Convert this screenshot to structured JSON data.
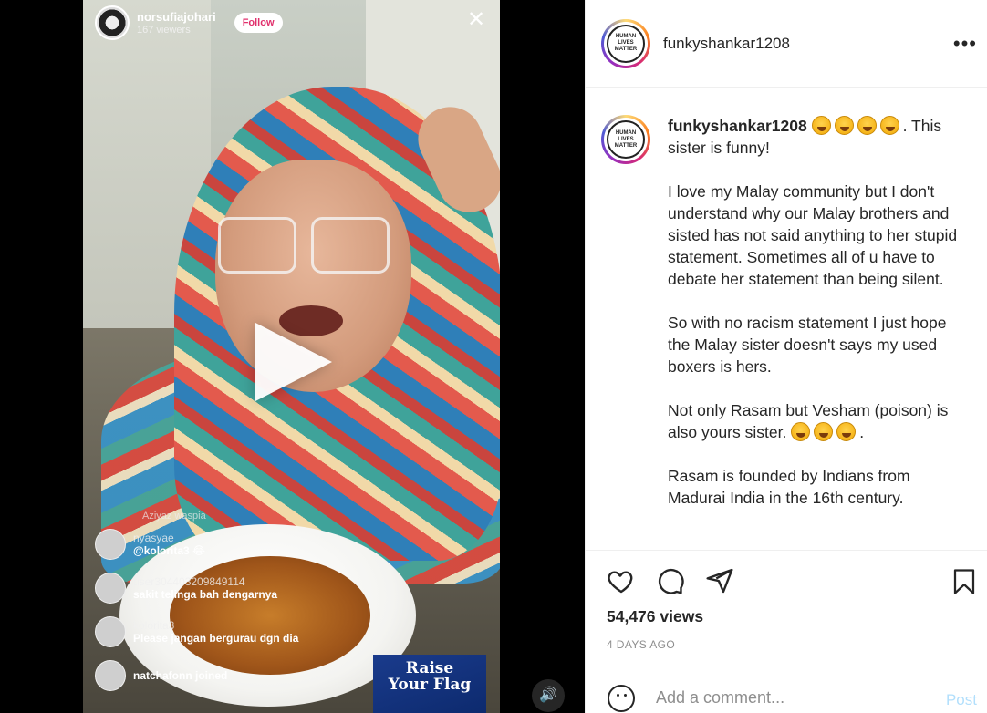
{
  "video": {
    "live_username": "norsufiajohari",
    "live_viewers": "167 viewers",
    "follow_label": "Follow",
    "close_glyph": "✕",
    "comments": [
      {
        "name": "nyasyae",
        "text": "@kolorita3 😂"
      },
      {
        "name": "user304403209849114",
        "text": "sakit telinga bah dengarnya"
      },
      {
        "name": "kolorita3",
        "text": "Please jangan bergurau dgn dia"
      },
      {
        "name": "",
        "text": "natchafonn joined"
      }
    ],
    "comment_top_snippet": "Aziyaz waspia",
    "banner_line1": "Raise",
    "banner_line2": "Your Flag",
    "volume_glyph": "🔊"
  },
  "post": {
    "username": "funkyshankar1208",
    "avatar_logo_text": "HUMAN LIVES MATTER",
    "more_glyph": "•••",
    "caption": {
      "user": "funkyshankar1208",
      "after_emoji_1": ". This sister is funny!",
      "p2": "I love my Malay community but I don't understand why our Malay brothers and sisted has not said anything to her stupid statement. Sometimes all of u have to debate her statement than being silent.",
      "p3": "So with no racism statement I just hope the Malay sister doesn't says my used boxers is hers.",
      "p4_text": "Not only Rasam but Vesham (poison) is also yours sister. ",
      "p4_end": ".",
      "p5": "Rasam is founded by Indians from Madurai India in the 16th century."
    },
    "views": "54,476 views",
    "date": "4 DAYS AGO",
    "comment_placeholder": "Add a comment...",
    "post_label": "Post",
    "colors": {
      "link_disabled": "#b2dffc",
      "muted": "#8e8e8e",
      "text": "#262626"
    }
  }
}
